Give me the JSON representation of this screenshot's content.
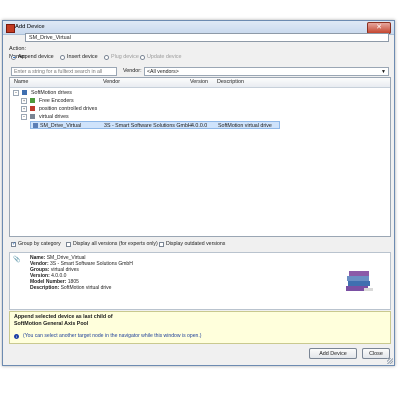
{
  "window": {
    "title": "Add Device"
  },
  "name_field": {
    "label": "Name:",
    "value": "SM_Drive_Virtual"
  },
  "action": {
    "label": "Action:",
    "options": [
      {
        "label": "Append device",
        "checked": true,
        "enabled": true
      },
      {
        "label": "Insert device",
        "checked": false,
        "enabled": true
      },
      {
        "label": "Plug device",
        "checked": false,
        "enabled": false
      },
      {
        "label": "Update device",
        "checked": false,
        "enabled": false
      }
    ]
  },
  "search": {
    "placeholder": "Enter a string for a fulltext search in all devices...",
    "vendor_label": "Vendor:",
    "vendor_value": "<All vendors>"
  },
  "tree": {
    "columns": [
      "Name",
      "Vendor",
      "Version",
      "Description"
    ],
    "rows": [
      {
        "name": "SoftMotion drives",
        "vendor": "",
        "version": "",
        "description": ""
      },
      {
        "name": "Free Encoders",
        "vendor": "",
        "version": "",
        "description": ""
      },
      {
        "name": "position controlled drives",
        "vendor": "",
        "version": "",
        "description": ""
      },
      {
        "name": "virtual drives",
        "vendor": "",
        "version": "",
        "description": ""
      },
      {
        "name": "SM_Drive_Virtual",
        "vendor": "3S - Smart Software Solutions GmbH",
        "version": "4.0.0.0",
        "description": "SoftMotion virtual drive"
      }
    ]
  },
  "checks": [
    {
      "label": "Group by category",
      "checked": true
    },
    {
      "label": "Display all versions (for experts only)",
      "checked": false
    },
    {
      "label": "Display outdated versions",
      "checked": false
    }
  ],
  "info": {
    "name_label": "Name:",
    "name": "SM_Drive_Virtual",
    "vendor_label": "Vendor:",
    "vendor": "3S - Smart Software Solutions GmbH",
    "groups_label": "Groups:",
    "groups": "virtual drives",
    "version_label": "Version:",
    "version": "4.0.0.0",
    "model_label": "Model Number:",
    "model": "1805",
    "desc_label": "Description:",
    "desc": "SoftMotion virtual drive"
  },
  "target": {
    "line1": "Append selected device as last child of",
    "line2": "SoftMotion General Axis Pool",
    "hint": "(You can select another target node in the navigator while this window is open.)"
  },
  "buttons": {
    "add": "Add Device",
    "close": "Close"
  },
  "icons": {
    "window": "app-icon",
    "close": "close-icon",
    "info": "paperclip-icon",
    "books": "books-icon",
    "hint": "info-icon"
  }
}
